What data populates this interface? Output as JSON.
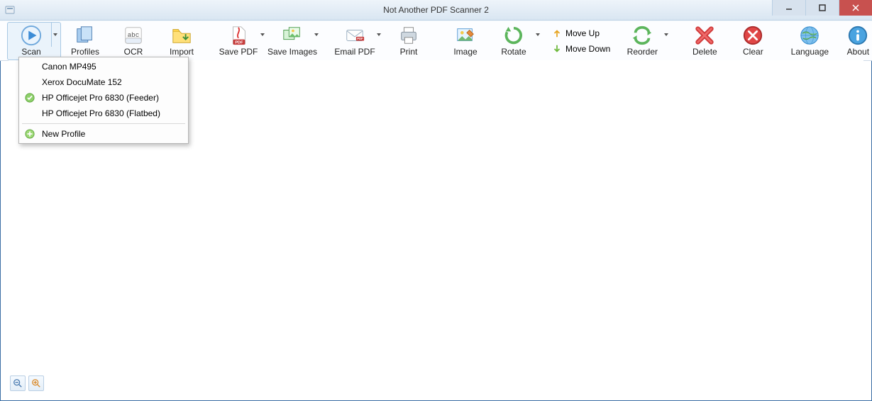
{
  "window": {
    "title": "Not Another PDF Scanner 2"
  },
  "toolbar": {
    "scan": "Scan",
    "profiles": "Profiles",
    "ocr": "OCR",
    "import": "Import",
    "save_pdf": "Save PDF",
    "save_images": "Save Images",
    "email_pdf": "Email PDF",
    "print": "Print",
    "image": "Image",
    "rotate": "Rotate",
    "move_up": "Move Up",
    "move_down": "Move Down",
    "reorder": "Reorder",
    "delete": "Delete",
    "clear": "Clear",
    "language": "Language",
    "about": "About"
  },
  "scan_menu": {
    "items": [
      {
        "label": "Canon MP495",
        "selected": false
      },
      {
        "label": "Xerox DocuMate 152",
        "selected": false
      },
      {
        "label": "HP Officejet Pro 6830 (Feeder)",
        "selected": true
      },
      {
        "label": "HP Officejet Pro 6830 (Flatbed)",
        "selected": false
      }
    ],
    "new_profile": "New Profile"
  }
}
